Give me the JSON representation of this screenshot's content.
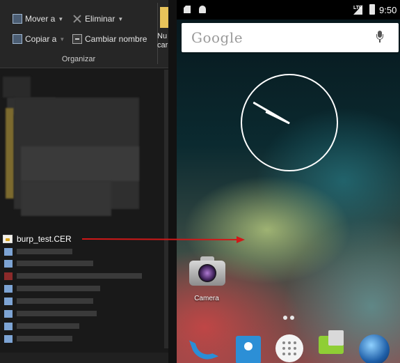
{
  "explorer": {
    "ribbon": {
      "move_label": "Mover a",
      "copy_label": "Copiar a",
      "delete_label": "Eliminar",
      "rename_label": "Cambiar nombre",
      "group_label": "Organizar",
      "new_label_line1": "Nu",
      "new_label_line2": "car"
    },
    "file_name": "burp_test.CER"
  },
  "android": {
    "time": "9:50",
    "network_label": "LTE",
    "search_logo": "Google",
    "camera_label": "Camera"
  },
  "colors": {
    "arrow": "#d01818",
    "explorer_bg": "#191919"
  }
}
